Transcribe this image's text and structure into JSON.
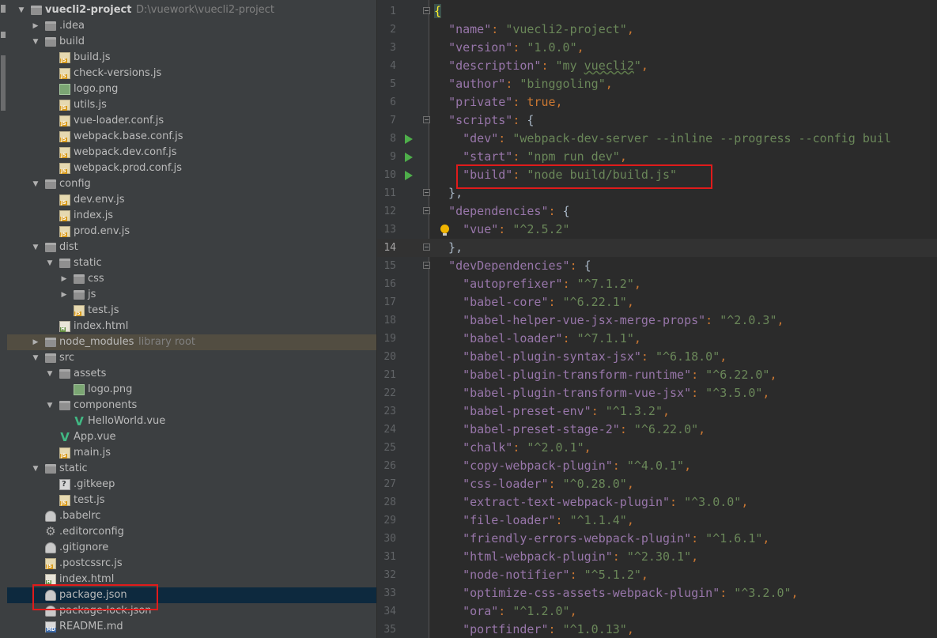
{
  "project_tree": {
    "rows": [
      {
        "depth": 0,
        "type": "folder",
        "expanded": true,
        "label": "vuecli2-project",
        "hint": "D:\\vuework\\vuecli2-project",
        "root": true
      },
      {
        "depth": 1,
        "type": "folder",
        "expanded": false,
        "label": ".idea"
      },
      {
        "depth": 1,
        "type": "folder",
        "expanded": true,
        "label": "build"
      },
      {
        "depth": 2,
        "type": "js",
        "label": "build.js"
      },
      {
        "depth": 2,
        "type": "js",
        "label": "check-versions.js"
      },
      {
        "depth": 2,
        "type": "png",
        "label": "logo.png"
      },
      {
        "depth": 2,
        "type": "js",
        "label": "utils.js"
      },
      {
        "depth": 2,
        "type": "js",
        "label": "vue-loader.conf.js"
      },
      {
        "depth": 2,
        "type": "js",
        "label": "webpack.base.conf.js"
      },
      {
        "depth": 2,
        "type": "js",
        "label": "webpack.dev.conf.js"
      },
      {
        "depth": 2,
        "type": "js",
        "label": "webpack.prod.conf.js"
      },
      {
        "depth": 1,
        "type": "folder",
        "expanded": true,
        "label": "config"
      },
      {
        "depth": 2,
        "type": "js",
        "label": "dev.env.js"
      },
      {
        "depth": 2,
        "type": "js",
        "label": "index.js"
      },
      {
        "depth": 2,
        "type": "js",
        "label": "prod.env.js"
      },
      {
        "depth": 1,
        "type": "folder",
        "expanded": true,
        "label": "dist"
      },
      {
        "depth": 2,
        "type": "folder",
        "expanded": true,
        "label": "static"
      },
      {
        "depth": 3,
        "type": "folder",
        "expanded": false,
        "label": "css"
      },
      {
        "depth": 3,
        "type": "folder",
        "expanded": false,
        "label": "js"
      },
      {
        "depth": 3,
        "type": "js",
        "label": "test.js"
      },
      {
        "depth": 2,
        "type": "html",
        "label": "index.html"
      },
      {
        "depth": 1,
        "type": "folder",
        "expanded": false,
        "label": "node_modules",
        "hint": "library root",
        "excluded": true
      },
      {
        "depth": 1,
        "type": "folder",
        "expanded": true,
        "label": "src"
      },
      {
        "depth": 2,
        "type": "folder",
        "expanded": true,
        "label": "assets"
      },
      {
        "depth": 3,
        "type": "png",
        "label": "logo.png"
      },
      {
        "depth": 2,
        "type": "folder",
        "expanded": true,
        "label": "components"
      },
      {
        "depth": 3,
        "type": "vue",
        "label": "HelloWorld.vue"
      },
      {
        "depth": 2,
        "type": "vue",
        "label": "App.vue"
      },
      {
        "depth": 2,
        "type": "js",
        "label": "main.js"
      },
      {
        "depth": 1,
        "type": "folder",
        "expanded": true,
        "label": "static"
      },
      {
        "depth": 2,
        "type": "gitkeep",
        "label": ".gitkeep"
      },
      {
        "depth": 2,
        "type": "js",
        "label": "test.js"
      },
      {
        "depth": 1,
        "type": "cfg",
        "label": ".babelrc"
      },
      {
        "depth": 1,
        "type": "gear",
        "label": ".editorconfig"
      },
      {
        "depth": 1,
        "type": "cfg",
        "label": ".gitignore"
      },
      {
        "depth": 1,
        "type": "js",
        "label": ".postcssrc.js"
      },
      {
        "depth": 1,
        "type": "html",
        "label": "index.html"
      },
      {
        "depth": 1,
        "type": "cfg",
        "label": "package.json",
        "selected": true
      },
      {
        "depth": 1,
        "type": "cfg",
        "label": "package-lock.json"
      },
      {
        "depth": 1,
        "type": "md",
        "label": "README.md"
      }
    ]
  },
  "editor": {
    "current_line": 14,
    "lines": [
      {
        "n": "1",
        "fold": true,
        "tokens": [
          [
            "brace-hl",
            "{"
          ]
        ]
      },
      {
        "n": "2",
        "tokens": [
          [
            "plain",
            "  "
          ],
          [
            "key",
            "\"name\""
          ],
          [
            "pun",
            ": "
          ],
          [
            "str",
            "\"vuecli2-project\""
          ],
          [
            "pun",
            ","
          ]
        ]
      },
      {
        "n": "3",
        "tokens": [
          [
            "plain",
            "  "
          ],
          [
            "key",
            "\"version\""
          ],
          [
            "pun",
            ": "
          ],
          [
            "str",
            "\"1.0.0\""
          ],
          [
            "pun",
            ","
          ]
        ]
      },
      {
        "n": "4",
        "tokens": [
          [
            "plain",
            "  "
          ],
          [
            "key",
            "\"description\""
          ],
          [
            "pun",
            ": "
          ],
          [
            "str",
            "\"my "
          ],
          [
            "str typo",
            "vuecli2"
          ],
          [
            "str",
            "\""
          ],
          [
            "pun",
            ","
          ]
        ]
      },
      {
        "n": "5",
        "tokens": [
          [
            "plain",
            "  "
          ],
          [
            "key",
            "\"author\""
          ],
          [
            "pun",
            ": "
          ],
          [
            "str",
            "\"binggoling\""
          ],
          [
            "pun",
            ","
          ]
        ]
      },
      {
        "n": "6",
        "tokens": [
          [
            "plain",
            "  "
          ],
          [
            "key",
            "\"private\""
          ],
          [
            "pun",
            ": true,"
          ]
        ]
      },
      {
        "n": "7",
        "fold": true,
        "tokens": [
          [
            "plain",
            "  "
          ],
          [
            "key",
            "\"scripts\""
          ],
          [
            "pun",
            ": "
          ],
          [
            "plain",
            "{"
          ]
        ]
      },
      {
        "n": "8",
        "run": true,
        "tokens": [
          [
            "plain",
            "    "
          ],
          [
            "key",
            "\"dev\""
          ],
          [
            "pun",
            ": "
          ],
          [
            "str",
            "\"webpack-dev-server --inline --progress --config buil"
          ]
        ]
      },
      {
        "n": "9",
        "run": true,
        "tokens": [
          [
            "plain",
            "    "
          ],
          [
            "key",
            "\"start\""
          ],
          [
            "pun",
            ": "
          ],
          [
            "str",
            "\"npm run dev\""
          ],
          [
            "pun",
            ","
          ]
        ]
      },
      {
        "n": "10",
        "run": true,
        "tokens": [
          [
            "plain",
            "    "
          ],
          [
            "key",
            "\"build\""
          ],
          [
            "pun",
            ": "
          ],
          [
            "str",
            "\"node build/build.js\""
          ]
        ]
      },
      {
        "n": "11",
        "fold": true,
        "tokens": [
          [
            "plain",
            "  },"
          ]
        ]
      },
      {
        "n": "12",
        "fold": true,
        "tokens": [
          [
            "plain",
            "  "
          ],
          [
            "key",
            "\"dependencies\""
          ],
          [
            "pun",
            ": "
          ],
          [
            "plain",
            "{"
          ]
        ]
      },
      {
        "n": "13",
        "bulb": true,
        "tokens": [
          [
            "plain",
            "    "
          ],
          [
            "key",
            "\"vue\""
          ],
          [
            "pun",
            ": "
          ],
          [
            "str",
            "\"^2.5.2\""
          ]
        ]
      },
      {
        "n": "14",
        "fold": true,
        "tokens": [
          [
            "plain",
            "  },"
          ]
        ]
      },
      {
        "n": "15",
        "fold": true,
        "tokens": [
          [
            "plain",
            "  "
          ],
          [
            "key",
            "\"devDependencies\""
          ],
          [
            "pun",
            ": "
          ],
          [
            "plain",
            "{"
          ]
        ]
      },
      {
        "n": "16",
        "tokens": [
          [
            "plain",
            "    "
          ],
          [
            "key",
            "\"autoprefixer\""
          ],
          [
            "pun",
            ": "
          ],
          [
            "str",
            "\"^7.1.2\""
          ],
          [
            "pun",
            ","
          ]
        ]
      },
      {
        "n": "17",
        "tokens": [
          [
            "plain",
            "    "
          ],
          [
            "key",
            "\"babel-core\""
          ],
          [
            "pun",
            ": "
          ],
          [
            "str",
            "\"^6.22.1\""
          ],
          [
            "pun",
            ","
          ]
        ]
      },
      {
        "n": "18",
        "tokens": [
          [
            "plain",
            "    "
          ],
          [
            "key",
            "\"babel-helper-vue-jsx-merge-props\""
          ],
          [
            "pun",
            ": "
          ],
          [
            "str",
            "\"^2.0.3\""
          ],
          [
            "pun",
            ","
          ]
        ]
      },
      {
        "n": "19",
        "tokens": [
          [
            "plain",
            "    "
          ],
          [
            "key",
            "\"babel-loader\""
          ],
          [
            "pun",
            ": "
          ],
          [
            "str",
            "\"^7.1.1\""
          ],
          [
            "pun",
            ","
          ]
        ]
      },
      {
        "n": "20",
        "tokens": [
          [
            "plain",
            "    "
          ],
          [
            "key",
            "\"babel-plugin-syntax-jsx\""
          ],
          [
            "pun",
            ": "
          ],
          [
            "str",
            "\"^6.18.0\""
          ],
          [
            "pun",
            ","
          ]
        ]
      },
      {
        "n": "21",
        "tokens": [
          [
            "plain",
            "    "
          ],
          [
            "key",
            "\"babel-plugin-transform-runtime\""
          ],
          [
            "pun",
            ": "
          ],
          [
            "str",
            "\"^6.22.0\""
          ],
          [
            "pun",
            ","
          ]
        ]
      },
      {
        "n": "22",
        "tokens": [
          [
            "plain",
            "    "
          ],
          [
            "key",
            "\"babel-plugin-transform-vue-jsx\""
          ],
          [
            "pun",
            ": "
          ],
          [
            "str",
            "\"^3.5.0\""
          ],
          [
            "pun",
            ","
          ]
        ]
      },
      {
        "n": "23",
        "tokens": [
          [
            "plain",
            "    "
          ],
          [
            "key",
            "\"babel-preset-env\""
          ],
          [
            "pun",
            ": "
          ],
          [
            "str",
            "\"^1.3.2\""
          ],
          [
            "pun",
            ","
          ]
        ]
      },
      {
        "n": "24",
        "tokens": [
          [
            "plain",
            "    "
          ],
          [
            "key",
            "\"babel-preset-stage-2\""
          ],
          [
            "pun",
            ": "
          ],
          [
            "str",
            "\"^6.22.0\""
          ],
          [
            "pun",
            ","
          ]
        ]
      },
      {
        "n": "25",
        "tokens": [
          [
            "plain",
            "    "
          ],
          [
            "key",
            "\"chalk\""
          ],
          [
            "pun",
            ": "
          ],
          [
            "str",
            "\"^2.0.1\""
          ],
          [
            "pun",
            ","
          ]
        ]
      },
      {
        "n": "26",
        "tokens": [
          [
            "plain",
            "    "
          ],
          [
            "key",
            "\"copy-webpack-plugin\""
          ],
          [
            "pun",
            ": "
          ],
          [
            "str",
            "\"^4.0.1\""
          ],
          [
            "pun",
            ","
          ]
        ]
      },
      {
        "n": "27",
        "tokens": [
          [
            "plain",
            "    "
          ],
          [
            "key",
            "\"css-loader\""
          ],
          [
            "pun",
            ": "
          ],
          [
            "str",
            "\"^0.28.0\""
          ],
          [
            "pun",
            ","
          ]
        ]
      },
      {
        "n": "28",
        "tokens": [
          [
            "plain",
            "    "
          ],
          [
            "key",
            "\"extract-text-webpack-plugin\""
          ],
          [
            "pun",
            ": "
          ],
          [
            "str",
            "\"^3.0.0\""
          ],
          [
            "pun",
            ","
          ]
        ]
      },
      {
        "n": "29",
        "tokens": [
          [
            "plain",
            "    "
          ],
          [
            "key",
            "\"file-loader\""
          ],
          [
            "pun",
            ": "
          ],
          [
            "str",
            "\"^1.1.4\""
          ],
          [
            "pun",
            ","
          ]
        ]
      },
      {
        "n": "30",
        "tokens": [
          [
            "plain",
            "    "
          ],
          [
            "key",
            "\"friendly-errors-webpack-plugin\""
          ],
          [
            "pun",
            ": "
          ],
          [
            "str",
            "\"^1.6.1\""
          ],
          [
            "pun",
            ","
          ]
        ]
      },
      {
        "n": "31",
        "tokens": [
          [
            "plain",
            "    "
          ],
          [
            "key",
            "\"html-webpack-plugin\""
          ],
          [
            "pun",
            ": "
          ],
          [
            "str",
            "\"^2.30.1\""
          ],
          [
            "pun",
            ","
          ]
        ]
      },
      {
        "n": "32",
        "tokens": [
          [
            "plain",
            "    "
          ],
          [
            "key",
            "\"node-notifier\""
          ],
          [
            "pun",
            ": "
          ],
          [
            "str",
            "\"^5.1.2\""
          ],
          [
            "pun",
            ","
          ]
        ]
      },
      {
        "n": "33",
        "tokens": [
          [
            "plain",
            "    "
          ],
          [
            "key",
            "\"optimize-css-assets-webpack-plugin\""
          ],
          [
            "pun",
            ": "
          ],
          [
            "str",
            "\"^3.2.0\""
          ],
          [
            "pun",
            ","
          ]
        ]
      },
      {
        "n": "34",
        "tokens": [
          [
            "plain",
            "    "
          ],
          [
            "key",
            "\"ora\""
          ],
          [
            "pun",
            ": "
          ],
          [
            "str",
            "\"^1.2.0\""
          ],
          [
            "pun",
            ","
          ]
        ]
      },
      {
        "n": "35",
        "tokens": [
          [
            "plain",
            "    "
          ],
          [
            "key",
            "\"portfinder\""
          ],
          [
            "pun",
            ": "
          ],
          [
            "str",
            "\"^1.0.13\""
          ],
          [
            "pun",
            ","
          ]
        ]
      }
    ]
  }
}
